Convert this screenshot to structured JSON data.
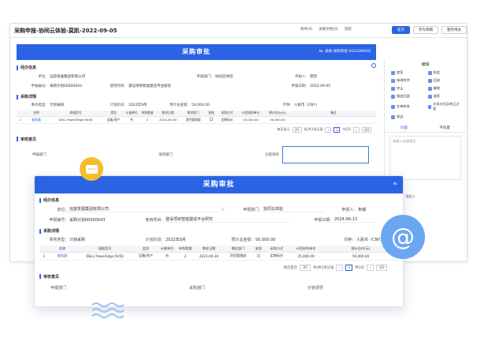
{
  "background_window": {
    "title": "采购申报-协同云体验-莫凯-2022-09-05",
    "toolbar": [
      "附件(0)",
      "关联文档(0)",
      "流程"
    ],
    "buttons": [
      "提交",
      "存为草稿",
      "暂存待办"
    ],
    "form": {
      "banner_title": "采购审批",
      "banner_no": "№: 采购-采购审批-2022090001",
      "section_info": "经办信息",
      "unit_label": "单位:",
      "unit_value": "远望发展集团有限公司",
      "dept_label": "申报部门:",
      "dept_value": "协同云体验",
      "person_label": "申报人:",
      "person_value": "莫凯",
      "code_label": "申报编号:",
      "code_value": "采购计划00000043",
      "project_label": "使用项目:",
      "project_value": "建设项目智能建造平台研究",
      "date_label": "申报日期:",
      "date_value": "2022-09-05",
      "section_detail": "采购详情",
      "type_label": "事务类型:",
      "type_value": "计划采购",
      "period_label": "计划阶段:",
      "period_value": "2022年9月",
      "amount_label": "预计总金额:",
      "amount_value": "50,000.00",
      "currency_label": "币种:",
      "currency_value": "人民币（CNY）",
      "table_headers": [
        "",
        "名称",
        "规格型号",
        "类别",
        "计量单位",
        "申购数量",
        "需求日期",
        "需求部门",
        "紧急",
        "采购方式",
        "计划采购单价",
        "预计总价(元)",
        "备注"
      ],
      "table_row": [
        "1",
        "服务器",
        "DELL PowerEdge R450",
        "设备/资产",
        "台",
        "2",
        "2022-09-30",
        "项目管理部",
        "",
        "定期标价",
        "25,000.00",
        "50,000.00",
        ""
      ],
      "pager_label": "每页显示",
      "pager_size": "20",
      "pager_text": "条/共1条记录",
      "pager_page": "1",
      "pager_total": "共1页",
      "go": "GO",
      "section_opinion": "审核意见",
      "op1": "申报部门",
      "op2": "采购部门",
      "op3": "分管领导"
    },
    "side": {
      "heading": "编辑",
      "items": [
        "加签",
        "知会",
        "修改附件",
        "回退",
        "终止",
        "撤销",
        "指定回退",
        "减签",
        "文单转发",
        "文本对比及修正过程",
        "知会"
      ],
      "tab_on": "同意",
      "tab_off": "不同意",
      "memo_placeholder": "请输入处理意见",
      "extra": [
        "跟踪",
        "全部",
        "指定人"
      ]
    }
  },
  "foreground_card": {
    "banner_title": "采购审批",
    "banner_no": "№:",
    "section_info": "经办信息",
    "unit_label": "单位:",
    "unit_value": "远望发展集团有限公司",
    "dept_label": "申报部门:",
    "dept_value": "协同云体验",
    "person_label": "申报人:",
    "person_value": "朱瑞",
    "code_label": "申报编号:",
    "code_value": "采购计划00000043",
    "project_label": "使用项目:",
    "project_value": "建设项目智能建造平台研究",
    "date_label": "申报日期:",
    "date_value": "2024-06-13",
    "section_detail": "采购详情",
    "type_label": "事务类型:",
    "type_value": "计划采购",
    "period_label": "计划阶段:",
    "period_value": "2022年9月",
    "amount_label": "预计总金额:",
    "amount_value": "50,000.00",
    "currency_label": "币种:",
    "currency_value": "人民币（CNY）",
    "table_headers": [
      "",
      "名称",
      "规格型号",
      "类别",
      "计量单位",
      "申购数量",
      "需求日期",
      "需求部门",
      "紧急",
      "采购方式",
      "计划采购单价",
      "预计总价(元)"
    ],
    "table_row": [
      "1",
      "服务器",
      "DELL PowerEdge R450",
      "设备/资产",
      "台",
      "2",
      "2022-09-30",
      "项目管理部",
      "",
      "定期标价",
      "25,000.00",
      "50,000.00"
    ],
    "pager_label": "每页显示",
    "pager_size": "20",
    "pager_text": "条/共1条记录",
    "pager_page": "1",
    "pager_total": "共1页",
    "go": "GO",
    "section_opinion": "审核意见",
    "op1": "申报部门",
    "op2": "采购部门",
    "op3": "分管领导"
  },
  "colors": {
    "accent": "#2a63e4",
    "chat_badge": "#f6bd2b",
    "at_badge": "#6ba6f1"
  },
  "icons": [
    "chat-bubble-icon",
    "at-sign-icon",
    "wave-decoration",
    "star-icon"
  ]
}
